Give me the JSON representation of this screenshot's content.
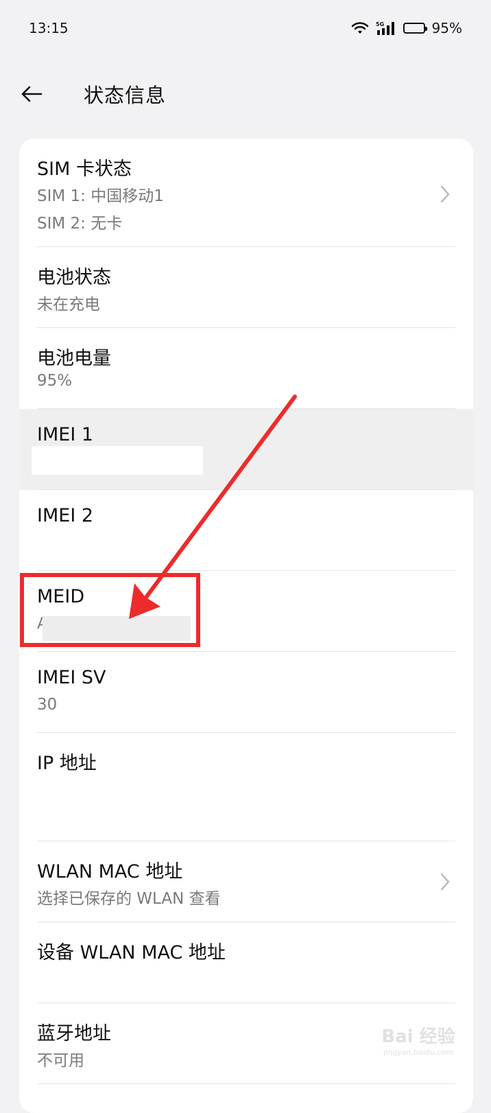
{
  "status_bar": {
    "time": "13:15",
    "network": "5G",
    "battery_percent": "95%",
    "battery_level": 0.95,
    "icons": [
      "wifi-icon",
      "signal-5g-icon",
      "battery-icon"
    ]
  },
  "header": {
    "back_icon": "arrow-left-icon",
    "title": "状态信息"
  },
  "rows": [
    {
      "title": "SIM 卡状态",
      "sub": "SIM 1: 中国移动1",
      "sub2": "SIM 2: 无卡",
      "chevron": true
    },
    {
      "title": "电池状态",
      "sub": "未在充电"
    },
    {
      "title": "电池电量",
      "sub": "95%"
    },
    {
      "title": "IMEI 1",
      "sub": ""
    },
    {
      "title": "IMEI 2",
      "sub": ""
    },
    {
      "title": "MEID",
      "sub": "A"
    },
    {
      "title": "IMEI SV",
      "sub": "30"
    },
    {
      "title": "IP 地址",
      "sub": ""
    },
    {
      "title": "WLAN MAC 地址",
      "sub": "选择已保存的 WLAN 查看",
      "chevron": true
    },
    {
      "title": "设备 WLAN MAC 地址",
      "sub": ""
    },
    {
      "title": "蓝牙地址",
      "sub": "不可用"
    }
  ],
  "annotation": {
    "color": "#ee2b2b"
  },
  "watermark": {
    "logo": "Bai 经验",
    "url": "jingyan.baidu.com"
  },
  "colors": {
    "background": "#f2f2f4",
    "card": "#ffffff",
    "subtext": "#7a7a7a",
    "highlight": "#efefef"
  }
}
